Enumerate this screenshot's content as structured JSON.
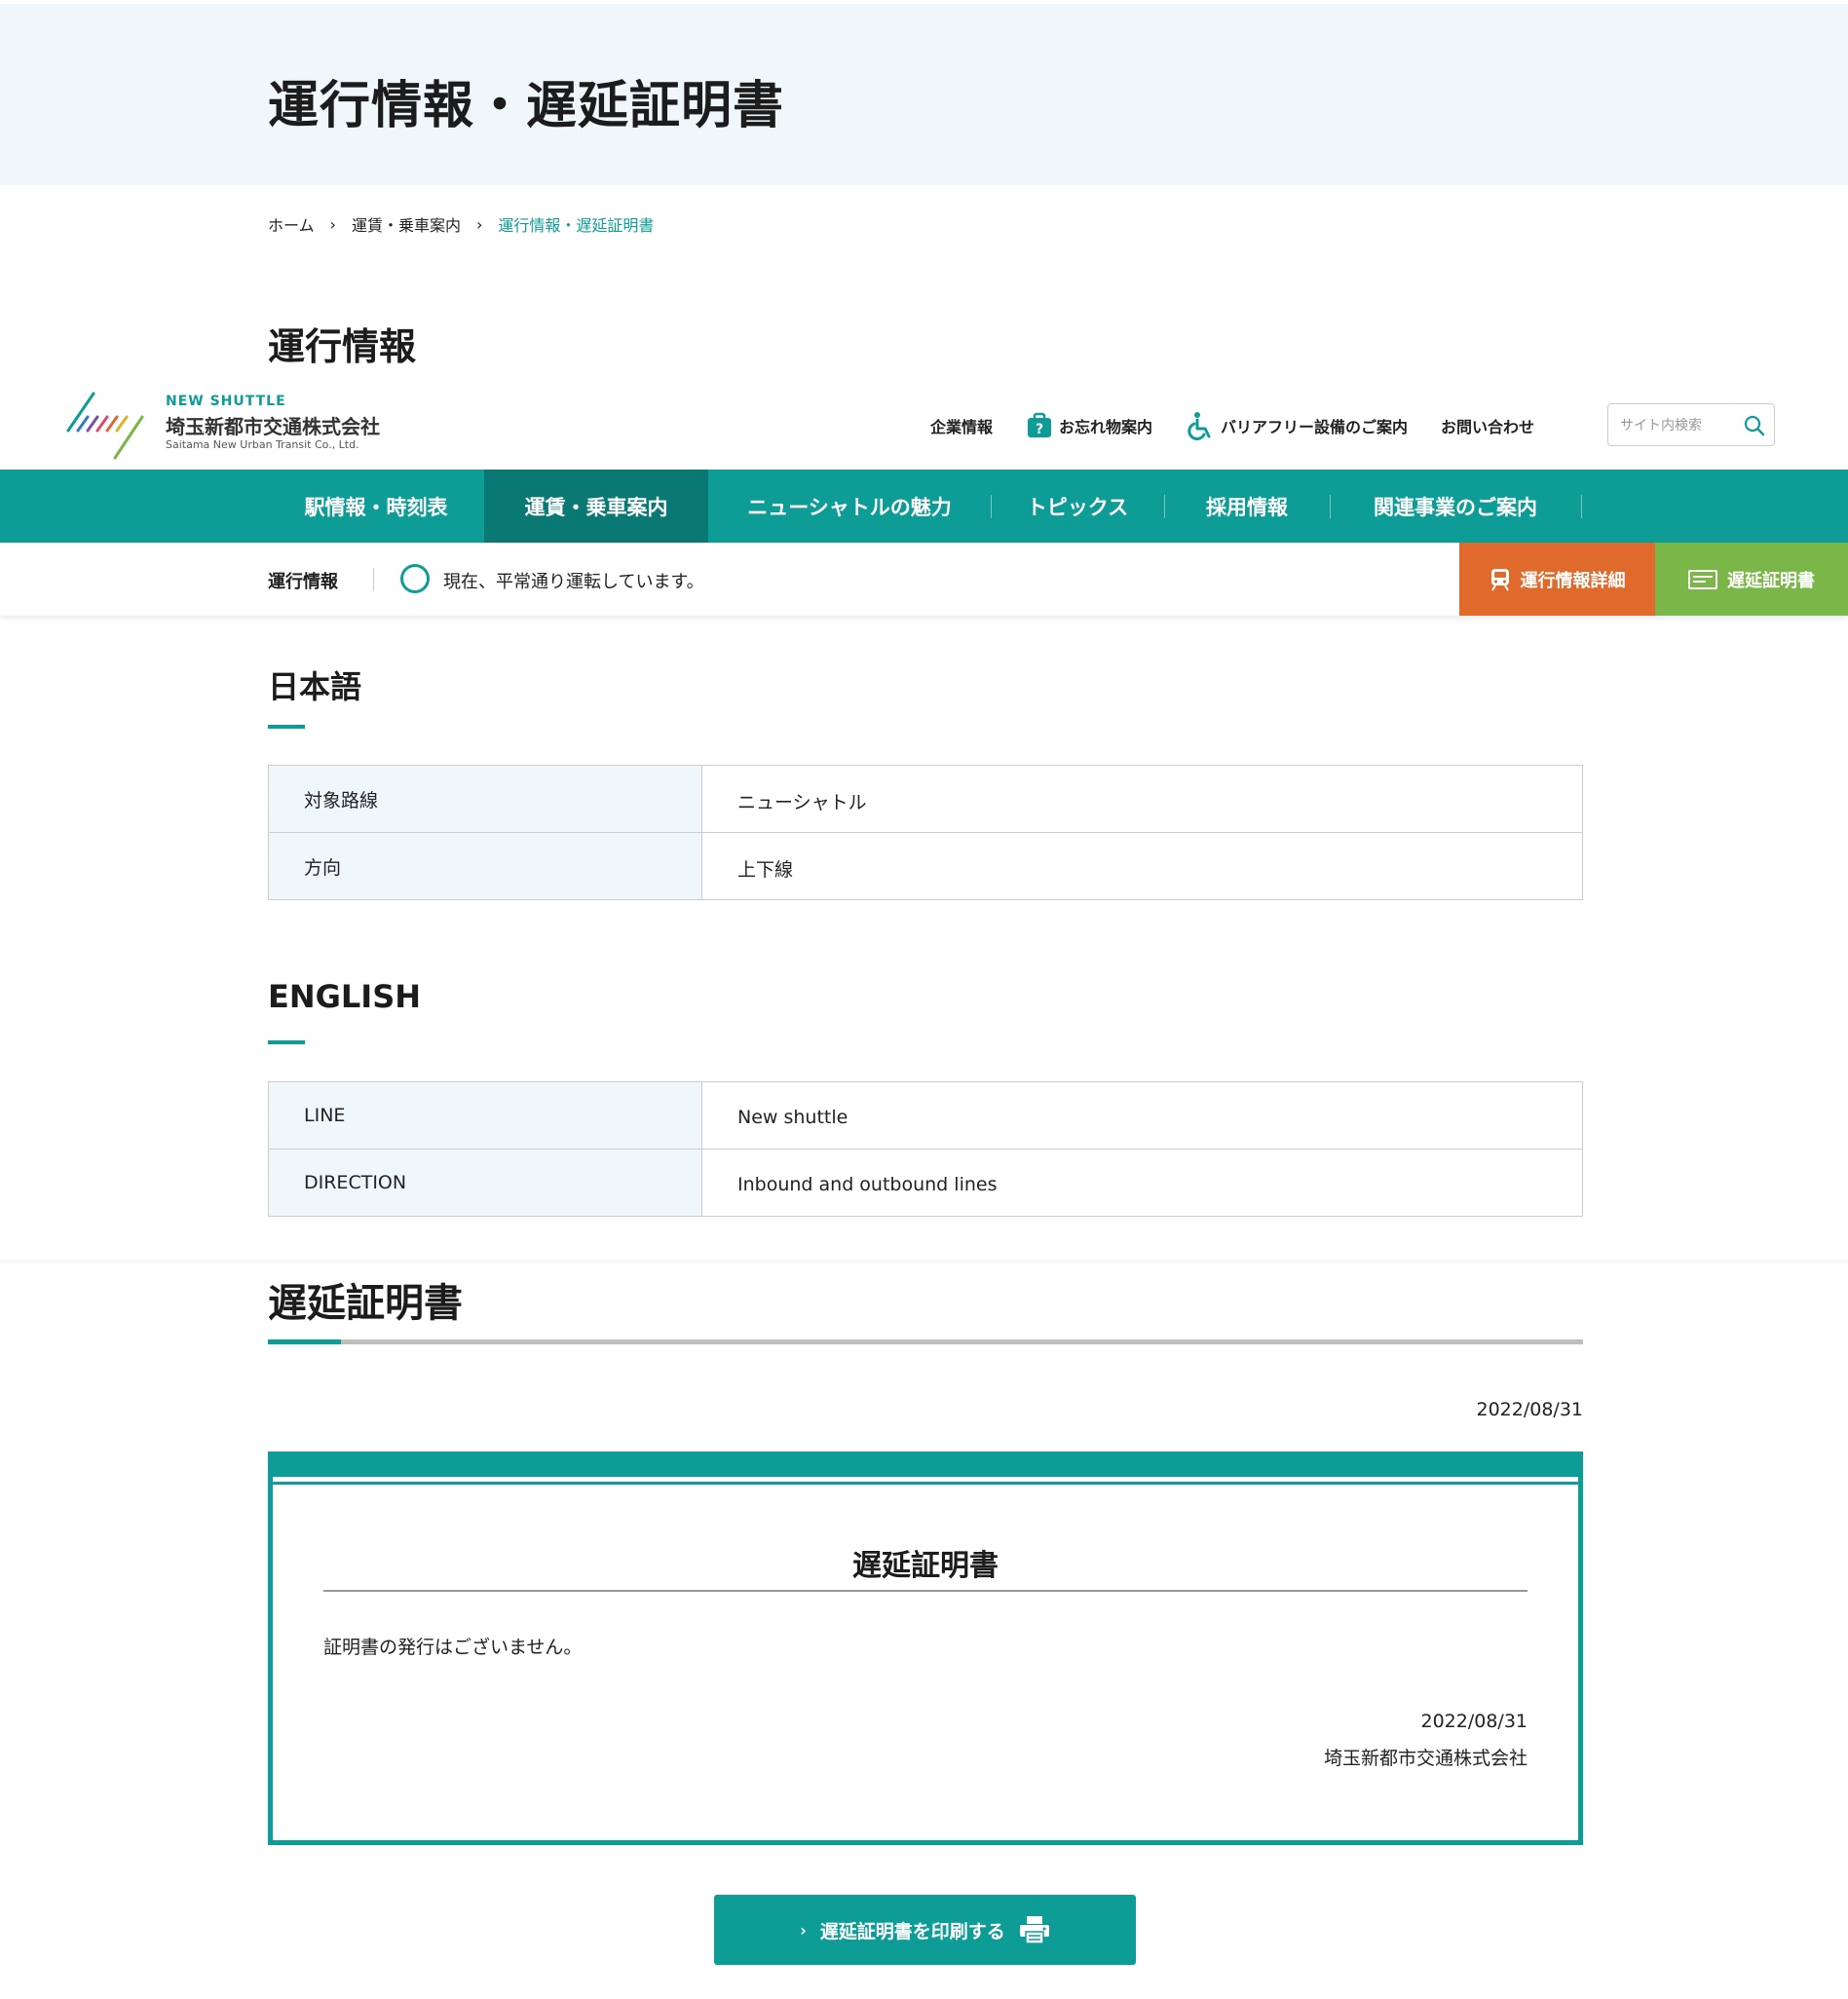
{
  "hero": {
    "title": "運行情報・遅延証明書"
  },
  "breadcrumb": {
    "items": [
      "ホーム",
      "運賃・乗車案内",
      "運行情報・遅延証明書"
    ],
    "separator": "›"
  },
  "operation": {
    "title": "運行情報"
  },
  "header": {
    "logo_en": "NEW SHUTTLE",
    "logo_ja": "埼玉新都市交通株式会社",
    "logo_sub": "Saitama New Urban Transit Co., Ltd.",
    "util_nav": [
      "企業情報",
      "お忘れ物案内",
      "バリアフリー設備のご案内",
      "お問い合わせ"
    ],
    "search_placeholder": "サイト内検索"
  },
  "main_nav": {
    "items": [
      "駅情報・時刻表",
      "運賃・乗車案内",
      "ニューシャトルの魅力",
      "トピックス",
      "採用情報",
      "関連事業のご案内"
    ],
    "active_index": 1
  },
  "status_bar": {
    "label": "運行情報",
    "status_text": "現在、平常通り運転しています。",
    "detail_button": "運行情報詳細",
    "cert_button": "遅延証明書"
  },
  "japanese": {
    "title": "日本語",
    "rows": [
      {
        "label": "対象路線",
        "value": "ニューシャトル"
      },
      {
        "label": "方向",
        "value": "上下線"
      }
    ]
  },
  "english": {
    "title": "ENGLISH",
    "rows": [
      {
        "label": "LINE",
        "value": "New shuttle"
      },
      {
        "label": "DIRECTION",
        "value": "Inbound and outbound lines"
      }
    ]
  },
  "delay": {
    "title": "遅延証明書",
    "date": "2022/08/31",
    "certificate": {
      "title": "遅延証明書",
      "message": "証明書の発行はございません。",
      "date": "2022/08/31",
      "company": "埼玉新都市交通株式会社"
    },
    "print_button": "遅延証明書を印刷する"
  },
  "colors": {
    "accent": "#0e9c96",
    "accent_dark": "#0a7873",
    "detail_button": "#e06a2c",
    "cert_button": "#7ab648",
    "hero_bg": "#f0f7fb"
  },
  "icons": {
    "search": "search-icon",
    "lost_item": "briefcase-question-icon",
    "barrier_free": "wheelchair-icon",
    "status": "circle-status-icon",
    "train": "train-icon",
    "certificate": "card-icon",
    "print": "printer-icon",
    "chevron": "chevron-right-icon"
  }
}
